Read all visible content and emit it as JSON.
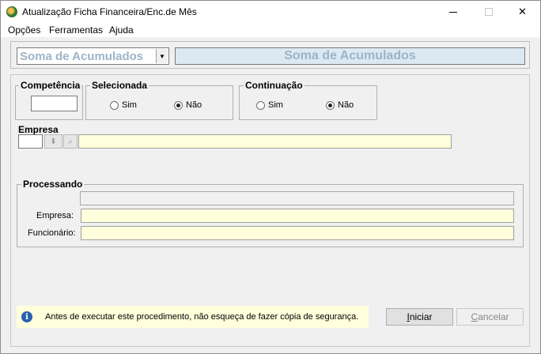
{
  "window": {
    "title": "Atualização Ficha Financeira/Enc.de Mês",
    "close_glyph": "✕"
  },
  "menu": {
    "items": [
      "Opções",
      "Ferramentas",
      "Ajuda"
    ]
  },
  "top": {
    "combo_value": "Soma de Acumulados",
    "header_text": "Soma de Acumulados"
  },
  "competencia": {
    "label": "Competência",
    "value": ""
  },
  "selecionada": {
    "label": "Selecionada",
    "options": [
      "Sim",
      "Não"
    ],
    "selected": "Não"
  },
  "continuacao": {
    "label": "Continuação",
    "options": [
      "Sim",
      "Não"
    ],
    "selected": "Não"
  },
  "empresa": {
    "label": "Empresa",
    "code": "",
    "name": ""
  },
  "processando": {
    "label": "Processando",
    "progress": 0,
    "empresa_label": "Empresa:",
    "empresa_value": "",
    "funcionario_label": "Funcionário:",
    "funcionario_value": ""
  },
  "info": {
    "icon": "info-icon",
    "text": "Antes de executar este procedimento, não esqueça de fazer cópia de segurança."
  },
  "buttons": {
    "iniciar_pre": "",
    "iniciar_key": "I",
    "iniciar_post": "niciar",
    "cancelar_pre": "",
    "cancelar_key": "C",
    "cancelar_post": "ancelar"
  }
}
